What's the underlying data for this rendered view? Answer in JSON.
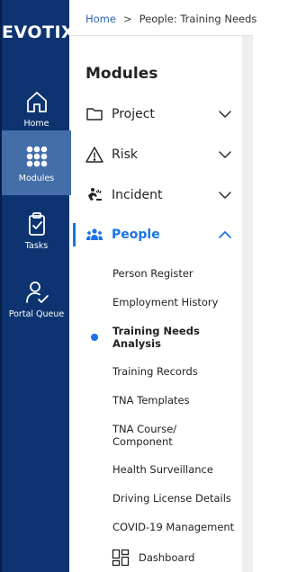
{
  "brand": {
    "logo_text": "EVOTIX"
  },
  "rail": {
    "items": [
      {
        "label": "Home",
        "icon": "home-icon"
      },
      {
        "label": "Modules",
        "icon": "grid-dots-icon",
        "active": true
      },
      {
        "label": "Tasks",
        "icon": "clipboard-check-icon"
      },
      {
        "label": "Portal Queue",
        "icon": "user-check-icon"
      }
    ]
  },
  "breadcrumb": {
    "home": "Home",
    "separator": ">",
    "current": "People: Training Needs"
  },
  "panel": {
    "title": "Modules"
  },
  "modules": [
    {
      "label": "Project",
      "icon": "folder-icon",
      "expanded": false
    },
    {
      "label": "Risk",
      "icon": "warning-triangle-icon",
      "expanded": false
    },
    {
      "label": "Incident",
      "icon": "incident-icon",
      "expanded": false
    },
    {
      "label": "People",
      "icon": "people-icon",
      "expanded": true,
      "active": true
    }
  ],
  "people_submenu": [
    {
      "label": "Person Register"
    },
    {
      "label": "Employment History"
    },
    {
      "label": "Training Needs Analysis",
      "current": true
    },
    {
      "label": "Training Records"
    },
    {
      "label": "TNA Templates"
    },
    {
      "label": "TNA Course/ Component"
    },
    {
      "label": "Health Surveillance"
    },
    {
      "label": "Driving License Details"
    },
    {
      "label": "COVID-19 Management"
    }
  ],
  "dashboard": {
    "label": "Dashboard",
    "icon": "dashboard-icon"
  },
  "colors": {
    "rail_bg": "#0d3470",
    "rail_active": "#436ea7",
    "accent": "#1a73e8",
    "breadcrumb_link": "#2a64b3"
  }
}
